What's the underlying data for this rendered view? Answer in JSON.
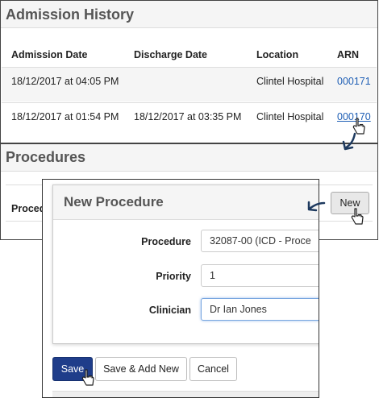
{
  "admission_history": {
    "title": "Admission History",
    "columns": [
      "Admission Date",
      "Discharge Date",
      "Location",
      "ARN"
    ],
    "rows": [
      {
        "admission": "18/12/2017 at 04:05 PM",
        "discharge": "",
        "location": "Clintel Hospital",
        "arn": "000171"
      },
      {
        "admission": "18/12/2017 at 01:54 PM",
        "discharge": "18/12/2017 at 03:35 PM",
        "location": "Clintel Hospital",
        "arn": "000170"
      }
    ]
  },
  "procedures": {
    "title": "Procedures",
    "column_partial": "Proced",
    "new_label": "New"
  },
  "modal": {
    "title": "New Procedure",
    "fields": [
      {
        "label": "Procedure",
        "value": "32087-00 (ICD - Proce"
      },
      {
        "label": "Priority",
        "value": "1"
      },
      {
        "label": "Clinician",
        "value": "Dr Ian Jones"
      }
    ],
    "buttons": {
      "save": "Save",
      "save_add_new": "Save & Add New",
      "cancel": "Cancel"
    }
  },
  "colors": {
    "link": "#1f5fb5",
    "primary_button": "#1f3d8a",
    "annotation_arrow": "#1e3a5f"
  },
  "icons": [
    "hand-cursor-icon",
    "curved-arrow-icon"
  ]
}
